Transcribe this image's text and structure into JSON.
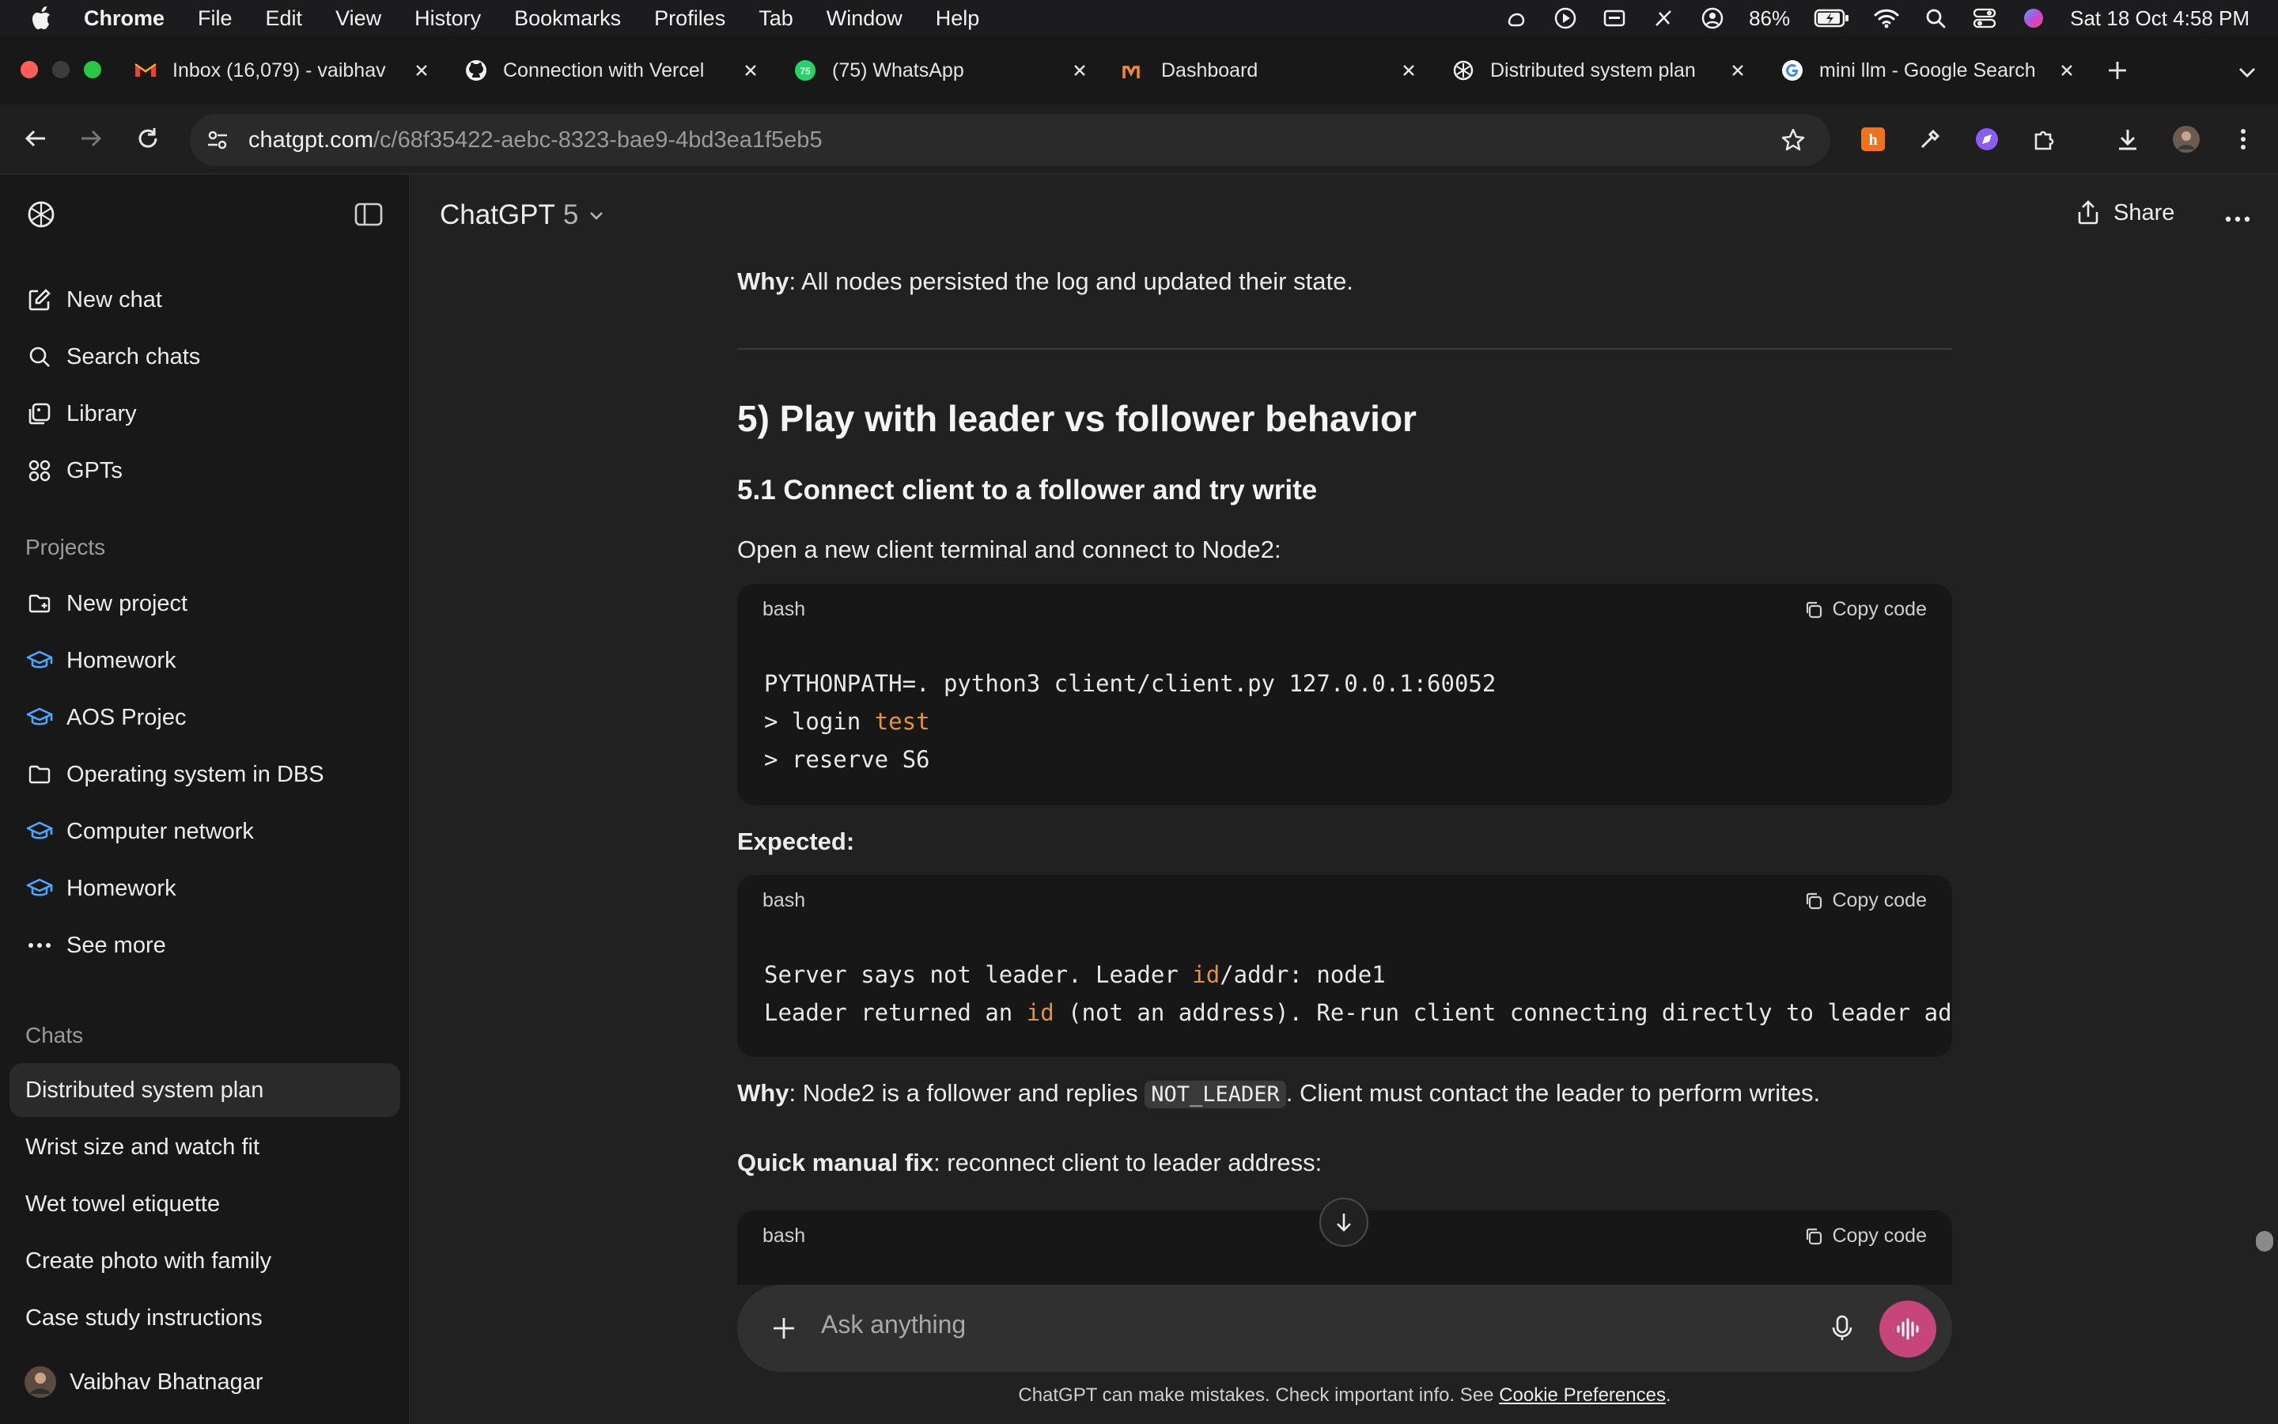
{
  "menubar": {
    "app": "Chrome",
    "items": [
      "File",
      "Edit",
      "View",
      "History",
      "Bookmarks",
      "Profiles",
      "Tab",
      "Window",
      "Help"
    ],
    "battery": "86%",
    "datetime": "Sat 18 Oct  4:58 PM"
  },
  "tabs": [
    {
      "label": "Inbox (16,079) - vaibhav",
      "icon": "gmail-icon"
    },
    {
      "label": "Connection with Vercel",
      "icon": "github-icon"
    },
    {
      "label": "(75) WhatsApp",
      "icon": "whatsapp-icon",
      "badge": "75"
    },
    {
      "label": "Dashboard",
      "icon": "dashboard-icon"
    },
    {
      "label": "Distributed system plan",
      "icon": "openai-icon"
    },
    {
      "label": "mini llm - Google Search",
      "icon": "google-icon"
    }
  ],
  "address": {
    "host": "chatgpt.com",
    "path": "/c/68f35422-aebc-8323-bae9-4bd3ea1f5eb5"
  },
  "sidebar": {
    "top_items": [
      {
        "label": "New chat",
        "icon": "new-chat-icon"
      },
      {
        "label": "Search chats",
        "icon": "search-icon"
      },
      {
        "label": "Library",
        "icon": "library-icon"
      },
      {
        "label": "GPTs",
        "icon": "gpts-icon"
      }
    ],
    "projects_heading": "Projects",
    "projects": [
      {
        "label": "New project",
        "icon": "new-folder-icon"
      },
      {
        "label": "Homework",
        "icon": "graduation-cap-icon"
      },
      {
        "label": "AOS Projec",
        "icon": "graduation-cap-icon"
      },
      {
        "label": "Operating system in DBS",
        "icon": "folder-icon"
      },
      {
        "label": "Computer network",
        "icon": "graduation-cap-icon"
      },
      {
        "label": "Homework",
        "icon": "graduation-cap-icon"
      },
      {
        "label": "See more",
        "icon": "ellipsis-icon"
      }
    ],
    "chats_heading": "Chats",
    "chats": [
      "Distributed system plan",
      "Wrist size and watch fit",
      "Wet towel etiquette",
      "Create photo with family",
      "Case study instructions"
    ],
    "user": "Vaibhav Bhatnagar"
  },
  "header": {
    "model": "ChatGPT",
    "version": "5",
    "share": "Share"
  },
  "content": {
    "why1_label": "Why",
    "why1_text": ": All nodes persisted the log and updated their state.",
    "h2": "5) Play with leader vs follower behavior",
    "h3": "5.1 Connect client to a follower and try write",
    "intro": "Open a new client terminal and connect to Node2:",
    "code1": {
      "lang": "bash",
      "copy": "Copy code",
      "line1": "PYTHONPATH=. python3 client/client.py 127.0.0.1:60052",
      "line2_pre": "> login ",
      "line2_kw": "test",
      "line3": "> reserve S6"
    },
    "expected": "Expected:",
    "code2": {
      "lang": "bash",
      "copy": "Copy code",
      "l1_a": "Server says not leader. Leader ",
      "l1_kw": "id",
      "l1_b": "/addr: node1",
      "l2_a": "Leader returned an ",
      "l2_kw": "id",
      "l2_b": " (not an address). Re-run client connecting directly to leader address."
    },
    "why2_label": "Why",
    "why2_a": ": Node2 is a follower and replies ",
    "why2_code": "NOT_LEADER",
    "why2_b": ". Client must contact the leader to perform writes.",
    "fix_label": "Quick manual fix",
    "fix_text": ": reconnect client to leader address:",
    "code3": {
      "lang": "bash",
      "copy": "Copy code"
    }
  },
  "composer": {
    "placeholder": "Ask anything"
  },
  "footer": {
    "text": "ChatGPT can make mistakes. Check important info. See ",
    "link": "Cookie Preferences",
    "end": "."
  },
  "colors": {
    "accent_voice": "#c6467c",
    "code_keyword": "#e3933a"
  }
}
